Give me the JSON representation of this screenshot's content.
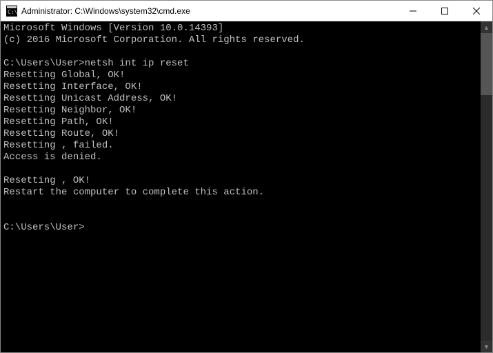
{
  "titlebar": {
    "title": "Administrator: C:\\Windows\\system32\\cmd.exe"
  },
  "terminal": {
    "header_line1": "Microsoft Windows [Version 10.0.14393]",
    "header_line2": "(c) 2016 Microsoft Corporation. All rights reserved.",
    "blank1": "",
    "prompt1": "C:\\Users\\User>netsh int ip reset",
    "out1": "Resetting Global, OK!",
    "out2": "Resetting Interface, OK!",
    "out3": "Resetting Unicast Address, OK!",
    "out4": "Resetting Neighbor, OK!",
    "out5": "Resetting Path, OK!",
    "out6": "Resetting Route, OK!",
    "out7": "Resetting , failed.",
    "out8": "Access is denied.",
    "blank2": "",
    "out9": "Resetting , OK!",
    "out10": "Restart the computer to complete this action.",
    "blank3": "",
    "blank4": "",
    "prompt2": "C:\\Users\\User>"
  },
  "icons": {
    "cmd": "cmd-icon",
    "minimize": "minimize-icon",
    "maximize": "maximize-icon",
    "close": "close-icon",
    "up": "chevron-up-icon",
    "down": "chevron-down-icon"
  }
}
